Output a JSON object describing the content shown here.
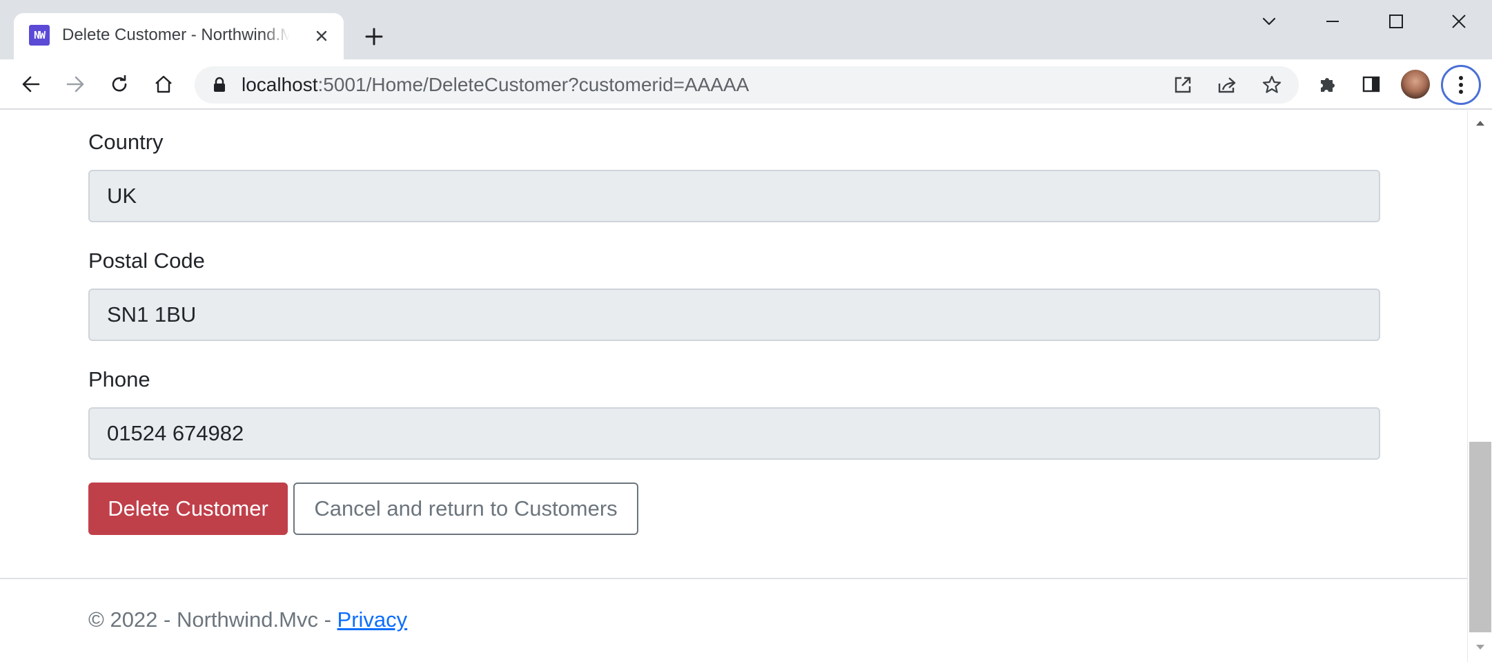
{
  "browser": {
    "tab_title": "Delete Customer - Northwind.Mvc",
    "favicon_text": "NW",
    "url_host": "localhost",
    "url_rest": ":5001/Home/DeleteCustomer?customerid=AAAAA",
    "accent_color": "#4a70d6"
  },
  "form": {
    "fields": [
      {
        "label": "Country",
        "value": "UK"
      },
      {
        "label": "Postal Code",
        "value": "SN1 1BU"
      },
      {
        "label": "Phone",
        "value": "01524 674982"
      }
    ],
    "delete_button": "Delete Customer",
    "cancel_button": "Cancel and return to Customers",
    "delete_color": "#c0404a"
  },
  "footer": {
    "text": "© 2022 - Northwind.Mvc - ",
    "link": "Privacy"
  }
}
